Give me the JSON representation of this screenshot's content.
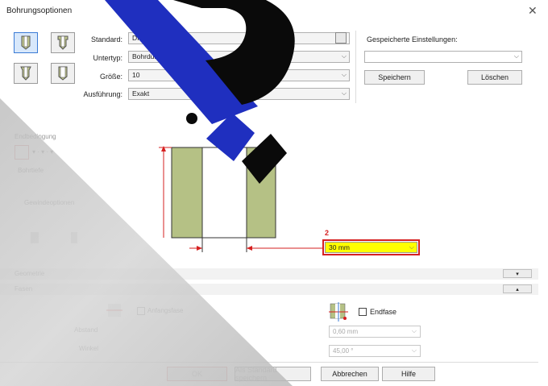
{
  "window": {
    "title": "Bohrungsoptionen"
  },
  "params": {
    "standard_label": "Standard:",
    "standard_value": "DIN Metric",
    "subtype_label": "Untertyp:",
    "subtype_value": "Bohrdurchmesser",
    "size_label": "Größe:",
    "size_value": "10",
    "execution_label": "Ausführung:",
    "execution_value": "Exakt"
  },
  "saved": {
    "label": "Gespeicherte Einstellungen:",
    "value": "",
    "save_label": "Speichern",
    "delete_label": "Löschen"
  },
  "left_panel": {
    "label_a": "Endbedingung",
    "label_b": "Bohrtiefe",
    "label_c": "Gewindeoptionen"
  },
  "dimension": {
    "marker": "2",
    "value": "30 mm"
  },
  "sections": {
    "geometry": "Geometrie",
    "fasen": "Fasen"
  },
  "chamfer": {
    "start_label": "Anfangsfase",
    "end_label": "Endfase",
    "distance_label": "Abstand",
    "angle_label": "Winkel",
    "end_distance": "0,60 mm",
    "end_angle": "45,00 °"
  },
  "footer": {
    "ok": "OK",
    "default": "Als Standard speichern",
    "cancel": "Abbrechen",
    "help": "Hilfe"
  },
  "colors": {
    "accent": "#3a7bd5",
    "highlight": "#ffff00",
    "marker": "#d62020",
    "wall": "#b5c185"
  }
}
